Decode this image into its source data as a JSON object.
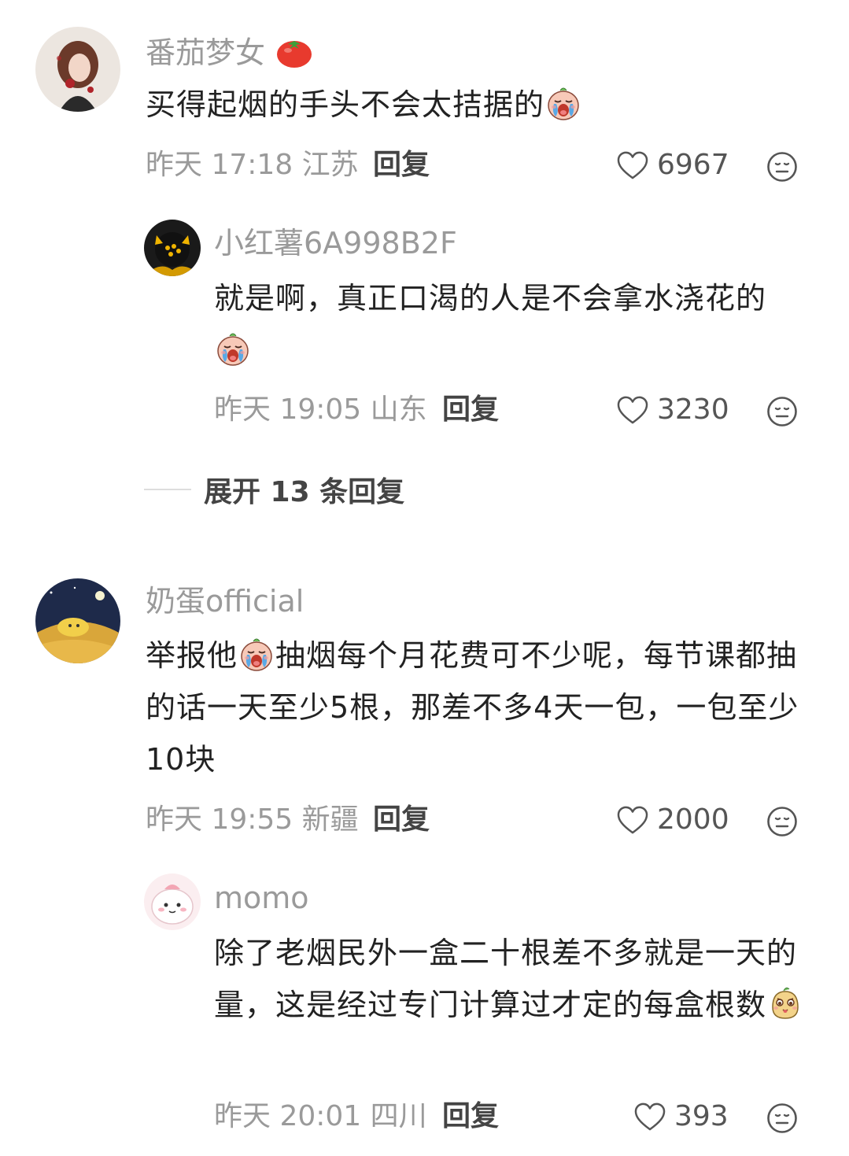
{
  "comments": [
    {
      "username": "番茄梦女",
      "text": "买得起烟的手头不会太拮据的",
      "date": "昨天",
      "time": "17:18",
      "location": "江苏",
      "reply_label": "回复",
      "likes": "6967",
      "replies": [
        {
          "username": "小红薯6A998B2F",
          "text": "就是啊，真正口渴的人是不会拿水浇花的",
          "date": "昨天",
          "time": "19:05",
          "location": "山东",
          "reply_label": "回复",
          "likes": "3230"
        }
      ],
      "expand_label": "展开 13 条回复"
    },
    {
      "username": "奶蛋official",
      "text_part1": "举报他",
      "text_part2": "抽烟每个月花费可不少呢，每节课都抽的话一天至少5根，那差不多4天一包，一包至少10块",
      "date": "昨天",
      "time": "19:55",
      "location": "新疆",
      "reply_label": "回复",
      "likes": "2000",
      "replies": [
        {
          "username": "momo",
          "text": "除了老烟民外一盒二十根差不多就是一天的量，这是经过专门计算过才定的每盒根数",
          "date": "昨天",
          "time": "20:01",
          "location": "四川",
          "reply_label": "回复",
          "likes": "393"
        }
      ]
    }
  ],
  "icons": {
    "like": "heart-outline-icon",
    "dislike": "neutral-face-icon",
    "name_badge": "tomato-emoji",
    "crying_emoji": "crying-face-sticker",
    "smug_emoji": "smug-potato-sticker"
  },
  "colors": {
    "username": "#9a9a9a",
    "text": "#222222",
    "meta": "#9a9a9a",
    "tomato": "#e83a2e"
  }
}
